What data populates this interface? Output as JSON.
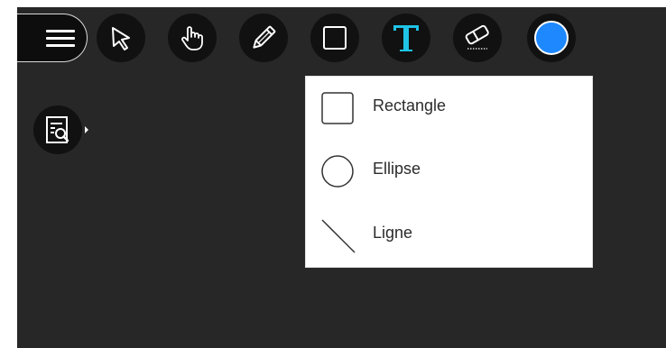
{
  "toolbar": {
    "tools": [
      {
        "icon": "menu-icon"
      },
      {
        "icon": "select-arrow-icon"
      },
      {
        "icon": "pan-hand-icon"
      },
      {
        "icon": "pencil-icon"
      },
      {
        "icon": "shape-rectangle-icon"
      },
      {
        "icon": "text-tool-icon",
        "selected": true,
        "accent": "#1fc3e6"
      },
      {
        "icon": "eraser-icon"
      },
      {
        "icon": "color-picker-icon",
        "color": "#1e88ff"
      }
    ]
  },
  "side_tool": {
    "icon": "search-document-icon"
  },
  "shape_menu": {
    "items": [
      {
        "icon": "rectangle-icon",
        "label": "Rectangle"
      },
      {
        "icon": "ellipse-icon",
        "label": "Ellipse"
      },
      {
        "icon": "line-icon",
        "label": "Ligne"
      }
    ]
  },
  "colors": {
    "canvas": "#272727",
    "tool_bg": "#111111",
    "accent_text": "#1fc3e6",
    "current_color": "#1e88ff"
  }
}
